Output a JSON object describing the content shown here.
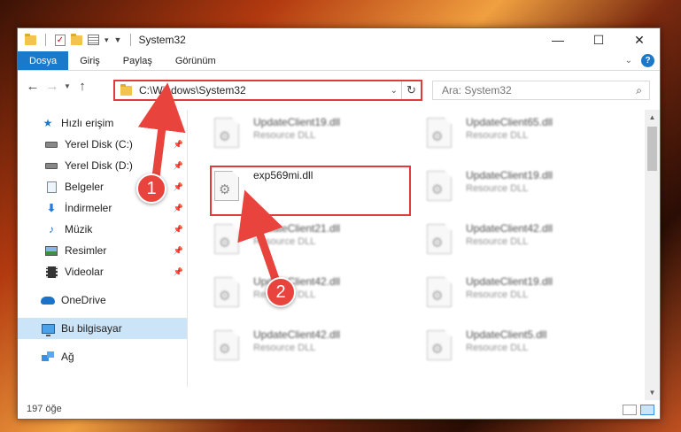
{
  "window": {
    "title": "System32",
    "controls": {
      "minimize": "—",
      "maximize": "☐",
      "close": "✕"
    }
  },
  "ribbon": {
    "tabs": [
      "Dosya",
      "Giriş",
      "Paylaş",
      "Görünüm"
    ],
    "help": "?"
  },
  "address": {
    "path": "C:\\Windows\\System32",
    "refresh": "↻"
  },
  "search": {
    "placeholder": "Ara: System32"
  },
  "sidebar": {
    "quick_access": "Hızlı erişim",
    "items": [
      {
        "label": "Yerel Disk (C:)",
        "icon": "disk-icon"
      },
      {
        "label": "Yerel Disk (D:)",
        "icon": "disk-icon"
      },
      {
        "label": "Belgeler",
        "icon": "documents-icon"
      },
      {
        "label": "İndirmeler",
        "icon": "download-icon"
      },
      {
        "label": "Müzik",
        "icon": "music-icon"
      },
      {
        "label": "Resimler",
        "icon": "pictures-icon"
      },
      {
        "label": "Videolar",
        "icon": "videos-icon"
      }
    ],
    "onedrive": "OneDrive",
    "this_pc": "Bu bilgisayar",
    "network": "Ağ"
  },
  "files": {
    "left": [
      {
        "name": "UpdateClient19.dll",
        "type": "Resource DLL"
      },
      {
        "name": "exp569mi.dll",
        "type": ""
      },
      {
        "name": "UpdateClient21.dll",
        "type": "Resource DLL"
      },
      {
        "name": "UpdateClient42.dll",
        "type": "Resource DLL"
      },
      {
        "name": "UpdateClient42.dll",
        "type": "Resource DLL"
      }
    ],
    "right": [
      {
        "name": "UpdateClient65.dll",
        "type": "Resource DLL"
      },
      {
        "name": "UpdateClient19.dll",
        "type": "Resource DLL"
      },
      {
        "name": "UpdateClient42.dll",
        "type": "Resource DLL"
      },
      {
        "name": "UpdateClient19.dll",
        "type": "Resource DLL"
      },
      {
        "name": "UpdateClient5.dll",
        "type": "Resource DLL"
      }
    ]
  },
  "status": {
    "count": "197 öğe"
  },
  "callouts": {
    "one": "1",
    "two": "2"
  },
  "colors": {
    "accent": "#1979ca",
    "highlight": "#e03a3a",
    "selected": "#cce4f7"
  }
}
